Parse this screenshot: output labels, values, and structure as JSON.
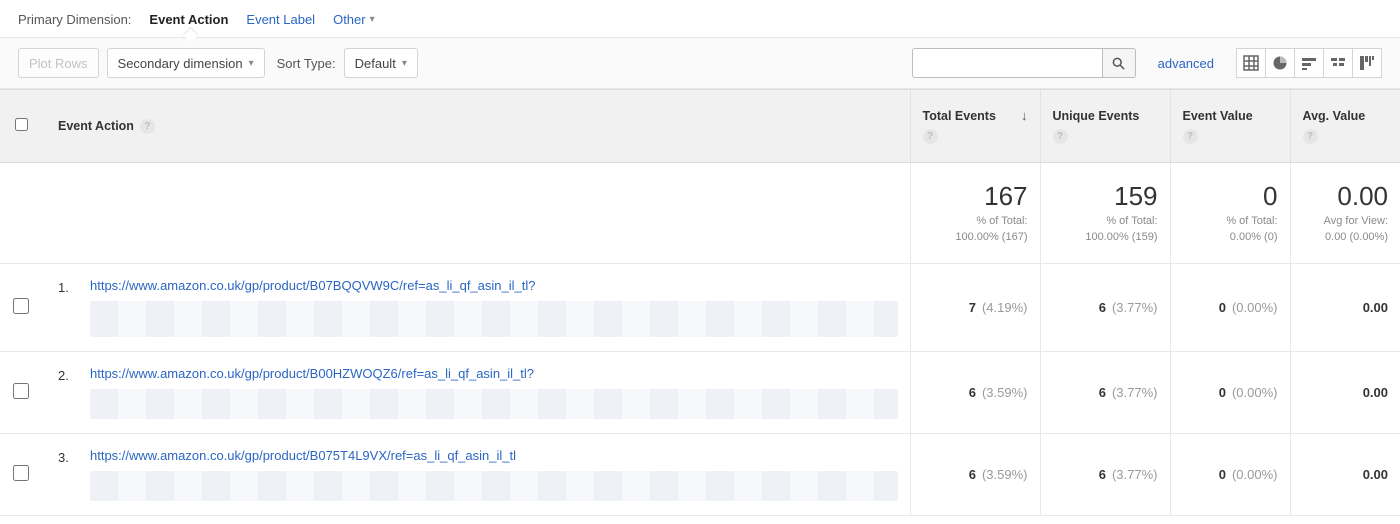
{
  "primaryDimension": {
    "label": "Primary Dimension:",
    "active": "Event Action",
    "tabs": [
      "Event Label"
    ],
    "other": "Other"
  },
  "toolbar": {
    "plotRows": "Plot Rows",
    "secondaryDimension": "Secondary dimension",
    "sortTypeLabel": "Sort Type:",
    "sortTypeValue": "Default",
    "advanced": "advanced"
  },
  "columns": {
    "eventAction": "Event Action",
    "totalEvents": "Total Events",
    "uniqueEvents": "Unique Events",
    "eventValue": "Event Value",
    "avgValue": "Avg. Value"
  },
  "summary": {
    "totalEvents": {
      "value": "167",
      "sub1": "% of Total:",
      "sub2": "100.00% (167)"
    },
    "uniqueEvents": {
      "value": "159",
      "sub1": "% of Total:",
      "sub2": "100.00% (159)"
    },
    "eventValue": {
      "value": "0",
      "sub1": "% of Total:",
      "sub2": "0.00% (0)"
    },
    "avgValue": {
      "value": "0.00",
      "sub1": "Avg for View:",
      "sub2": "0.00 (0.00%)"
    }
  },
  "rows": [
    {
      "no": "1.",
      "link": "https://www.amazon.co.uk/gp/product/B07BQQVW9C/ref=as_li_qf_asin_il_tl?",
      "totalEvents": {
        "v": "7",
        "p": "(4.19%)"
      },
      "uniqueEvents": {
        "v": "6",
        "p": "(3.77%)"
      },
      "eventValue": {
        "v": "0",
        "p": "(0.00%)"
      },
      "avgValue": {
        "v": "0.00",
        "p": ""
      }
    },
    {
      "no": "2.",
      "link": "https://www.amazon.co.uk/gp/product/B00HZWOQZ6/ref=as_li_qf_asin_il_tl?",
      "totalEvents": {
        "v": "6",
        "p": "(3.59%)"
      },
      "uniqueEvents": {
        "v": "6",
        "p": "(3.77%)"
      },
      "eventValue": {
        "v": "0",
        "p": "(0.00%)"
      },
      "avgValue": {
        "v": "0.00",
        "p": ""
      }
    },
    {
      "no": "3.",
      "link": "https://www.amazon.co.uk/gp/product/B075T4L9VX/ref=as_li_qf_asin_il_tl",
      "totalEvents": {
        "v": "6",
        "p": "(3.59%)"
      },
      "uniqueEvents": {
        "v": "6",
        "p": "(3.77%)"
      },
      "eventValue": {
        "v": "0",
        "p": "(0.00%)"
      },
      "avgValue": {
        "v": "0.00",
        "p": ""
      }
    }
  ]
}
